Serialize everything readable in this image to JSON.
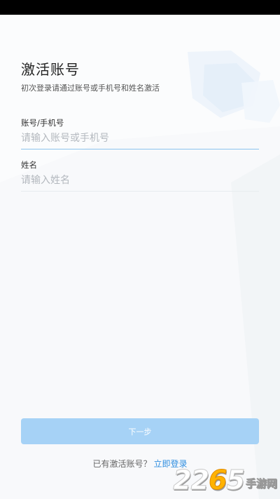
{
  "header": {
    "title": "激活账号",
    "subtitle": "初次登录请通过账号或手机号和姓名激活"
  },
  "form": {
    "account": {
      "label": "账号/手机号",
      "placeholder": "请输入账号或手机号",
      "value": ""
    },
    "name": {
      "label": "姓名",
      "placeholder": "请输入姓名",
      "value": ""
    },
    "next_label": "下一步"
  },
  "footer": {
    "prompt": "已有激活账号？",
    "login_link": "立即登录"
  },
  "watermark": {
    "number_a": "22",
    "number_b": "6",
    "number_c": "5",
    "text": "手游网"
  },
  "colors": {
    "accent": "#2f8ee0",
    "button_disabled": "#a6d2f6",
    "active_underline": "#8cc4ee",
    "inactive_underline": "#e8ecef"
  }
}
